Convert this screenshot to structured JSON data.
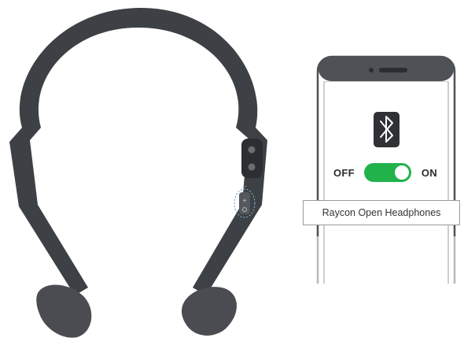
{
  "toggle": {
    "off_label": "OFF",
    "on_label": "ON",
    "state": "on"
  },
  "device_list": {
    "device_name": "Raycon Open Headphones"
  },
  "headphone_buttons": {
    "minus_symbol": "−",
    "plus_symbol": "+"
  },
  "colors": {
    "headphone": "#3d4044",
    "headphone_pad": "#4a4c51",
    "phone_frame": "#4e5156",
    "toggle_on": "#22b24c",
    "bluetooth_badge": "#2f3134"
  },
  "icons": [
    "bluetooth-icon",
    "camera-icon",
    "speaker-icon"
  ]
}
